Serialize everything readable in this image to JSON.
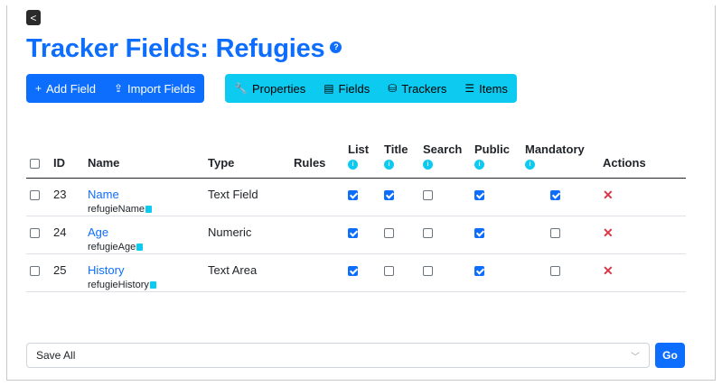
{
  "back_label": "<",
  "title": "Tracker Fields: Refugies",
  "toolbar_primary": [
    {
      "icon": "+",
      "label": "Add Field"
    },
    {
      "icon": "⇪",
      "label": "Import Fields"
    }
  ],
  "toolbar_secondary": [
    {
      "icon": "🔧",
      "label": "Properties"
    },
    {
      "icon": "▤",
      "label": "Fields"
    },
    {
      "icon": "⛁",
      "label": "Trackers"
    },
    {
      "icon": "☰",
      "label": "Items"
    }
  ],
  "columns": {
    "id": "ID",
    "name": "Name",
    "type": "Type",
    "rules": "Rules",
    "list": "List",
    "title": "Title",
    "search": "Search",
    "public": "Public",
    "mandatory": "Mandatory",
    "actions": "Actions"
  },
  "rows": [
    {
      "id": "23",
      "name": "Name",
      "code": "refugieName",
      "type": "Text Field",
      "list": true,
      "title": true,
      "search": false,
      "public": true,
      "mandatory": true
    },
    {
      "id": "24",
      "name": "Age",
      "code": "refugieAge",
      "type": "Numeric",
      "list": true,
      "title": false,
      "search": false,
      "public": true,
      "mandatory": false
    },
    {
      "id": "25",
      "name": "History",
      "code": "refugieHistory",
      "type": "Text Area",
      "list": true,
      "title": false,
      "search": false,
      "public": true,
      "mandatory": false
    }
  ],
  "bulk_action": {
    "selected": "Save All"
  },
  "go_label": "Go",
  "colors": {
    "primary": "#0d6efd",
    "info": "#0dcaf0",
    "danger": "#dc3545"
  }
}
